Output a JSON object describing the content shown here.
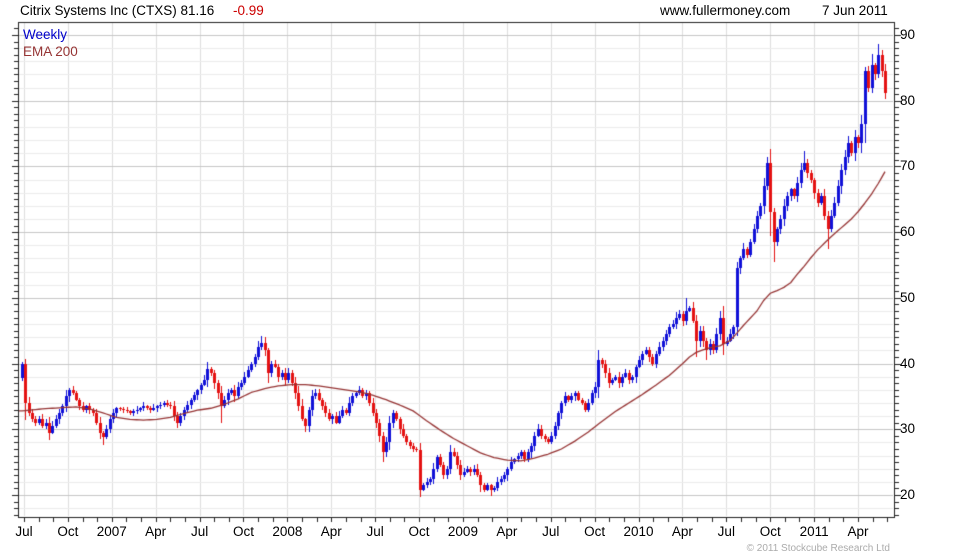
{
  "header": {
    "title": "Citrix Systems Inc (CTXS) 81.16",
    "change": "-0.99",
    "site": "www.fullermoney.com",
    "date": "7 Jun 2011"
  },
  "legend": {
    "timeframe": "Weekly",
    "overlay": "EMA 200"
  },
  "footer": {
    "copyright": "© 2011 Stockcube Research Ltd"
  },
  "colors": {
    "up": "#1111d8",
    "down": "#e41212",
    "ema": "#963434",
    "change_text": "#cc0000",
    "legend_weekly": "#0000cc",
    "axis": "#222222",
    "grid_major": "#c6c6c6",
    "grid_minor": "#ececec",
    "grid_vertical": "#dedede",
    "copyright_text": "#ababab"
  },
  "chart_data": {
    "type": "candlestick",
    "title": "Citrix Systems Inc (CTXS)",
    "last_price": 81.16,
    "change": -0.99,
    "timeframe": "Weekly",
    "overlay": "EMA 200",
    "y_axis": {
      "tick_values": [
        20,
        30,
        40,
        50,
        60,
        70,
        80,
        90
      ],
      "tick_labels": [
        "20",
        "30",
        "40",
        "50",
        "60",
        "70",
        "80",
        "90"
      ],
      "minor_tick_step": 1,
      "minor_grid_step": 2,
      "ylim": [
        16.6,
        92.0
      ],
      "side": "right"
    },
    "x_axis": {
      "tick_labels": [
        "Jul",
        "Oct",
        "2007",
        "Apr",
        "Jul",
        "Oct",
        "2008",
        "Apr",
        "Jul",
        "Oct",
        "2009",
        "Apr",
        "Jul",
        "Oct",
        "2010",
        "Apr",
        "Jul",
        "Oct",
        "2011",
        "Apr"
      ],
      "months_per_tick": 3,
      "range": "Jul 2006 - Jun 2011"
    },
    "weeks": 257,
    "first_open": 37.8,
    "close_anchors": [
      [
        0,
        39.9
      ],
      [
        1,
        34.0
      ],
      [
        2,
        32.5
      ],
      [
        3,
        31.5
      ],
      [
        4,
        31.0
      ],
      [
        5,
        31.5
      ],
      [
        6,
        30.5
      ],
      [
        7,
        31.0
      ],
      [
        8,
        29.5
      ],
      [
        9,
        30.5
      ],
      [
        10,
        31.5
      ],
      [
        11,
        32.5
      ],
      [
        12,
        33.5
      ],
      [
        13,
        35.0
      ],
      [
        14,
        36.0
      ],
      [
        15,
        35.5
      ],
      [
        16,
        34.5
      ],
      [
        17,
        33.5
      ],
      [
        18,
        33.0
      ],
      [
        19,
        33.5
      ],
      [
        20,
        33.0
      ],
      [
        21,
        32.5
      ],
      [
        22,
        31.0
      ],
      [
        23,
        29.5
      ],
      [
        24,
        28.8
      ],
      [
        25,
        30.0
      ],
      [
        26,
        31.5
      ],
      [
        27,
        32.5
      ],
      [
        28,
        33.2
      ],
      [
        30,
        33.0
      ],
      [
        32,
        32.5
      ],
      [
        34,
        33.0
      ],
      [
        36,
        33.5
      ],
      [
        38,
        33.0
      ],
      [
        40,
        33.5
      ],
      [
        42,
        34.0
      ],
      [
        44,
        33.5
      ],
      [
        45,
        32.0
      ],
      [
        46,
        31.0
      ],
      [
        47,
        32.0
      ],
      [
        48,
        33.0
      ],
      [
        50,
        34.5
      ],
      [
        52,
        36.0
      ],
      [
        54,
        37.5
      ],
      [
        55,
        39.2
      ],
      [
        56,
        38.5
      ],
      [
        57,
        37.0
      ],
      [
        58,
        35.5
      ],
      [
        59,
        33.5
      ],
      [
        60,
        34.5
      ],
      [
        61,
        35.5
      ],
      [
        62,
        36.0
      ],
      [
        63,
        35.0
      ],
      [
        64,
        36.5
      ],
      [
        65,
        37.0
      ],
      [
        66,
        38.0
      ],
      [
        67,
        39.0
      ],
      [
        68,
        40.0
      ],
      [
        69,
        41.0
      ],
      [
        70,
        42.5
      ],
      [
        71,
        43.2
      ],
      [
        72,
        42.0
      ],
      [
        73,
        38.5
      ],
      [
        74,
        40.0
      ],
      [
        75,
        39.5
      ],
      [
        76,
        38.0
      ],
      [
        77,
        38.5
      ],
      [
        78,
        37.5
      ],
      [
        79,
        38.5
      ],
      [
        80,
        37.0
      ],
      [
        81,
        35.5
      ],
      [
        82,
        33.5
      ],
      [
        83,
        31.5
      ],
      [
        84,
        30.5
      ],
      [
        85,
        33.0
      ],
      [
        86,
        35.0
      ],
      [
        87,
        35.5
      ],
      [
        88,
        34.5
      ],
      [
        89,
        33.5
      ],
      [
        90,
        32.5
      ],
      [
        91,
        31.5
      ],
      [
        92,
        32.0
      ],
      [
        93,
        31.0
      ],
      [
        94,
        32.0
      ],
      [
        95,
        33.0
      ],
      [
        96,
        32.5
      ],
      [
        97,
        34.0
      ],
      [
        98,
        35.0
      ],
      [
        99,
        35.5
      ],
      [
        100,
        36.0
      ],
      [
        101,
        35.0
      ],
      [
        102,
        35.5
      ],
      [
        103,
        34.0
      ],
      [
        104,
        32.5
      ],
      [
        105,
        31.0
      ],
      [
        106,
        29.0
      ],
      [
        107,
        26.5
      ],
      [
        108,
        28.0
      ],
      [
        109,
        31.0
      ],
      [
        110,
        32.5
      ],
      [
        111,
        31.5
      ],
      [
        112,
        30.0
      ],
      [
        113,
        29.0
      ],
      [
        114,
        28.0
      ],
      [
        115,
        27.5
      ],
      [
        116,
        27.0
      ],
      [
        117,
        26.8
      ],
      [
        118,
        20.8
      ],
      [
        119,
        21.5
      ],
      [
        120,
        22.0
      ],
      [
        121,
        22.5
      ],
      [
        122,
        24.0
      ],
      [
        123,
        25.8
      ],
      [
        124,
        24.5
      ],
      [
        125,
        23.0
      ],
      [
        126,
        24.0
      ],
      [
        127,
        26.5
      ],
      [
        128,
        26.0
      ],
      [
        129,
        24.5
      ],
      [
        130,
        23.0
      ],
      [
        131,
        23.5
      ],
      [
        132,
        24.0
      ],
      [
        133,
        23.5
      ],
      [
        134,
        24.0
      ],
      [
        135,
        23.0
      ],
      [
        136,
        21.5
      ],
      [
        137,
        20.8
      ],
      [
        138,
        21.5
      ],
      [
        139,
        20.8
      ],
      [
        140,
        21.0
      ],
      [
        141,
        22.0
      ],
      [
        142,
        22.5
      ],
      [
        143,
        23.0
      ],
      [
        144,
        24.0
      ],
      [
        145,
        25.0
      ],
      [
        146,
        25.5
      ],
      [
        147,
        26.0
      ],
      [
        148,
        26.5
      ],
      [
        149,
        25.5
      ],
      [
        150,
        26.5
      ],
      [
        151,
        27.5
      ],
      [
        152,
        29.0
      ],
      [
        153,
        30.0
      ],
      [
        154,
        29.0
      ],
      [
        155,
        28.5
      ],
      [
        156,
        28.0
      ],
      [
        157,
        29.0
      ],
      [
        158,
        30.5
      ],
      [
        159,
        32.5
      ],
      [
        160,
        34.0
      ],
      [
        161,
        35.0
      ],
      [
        162,
        34.5
      ],
      [
        163,
        35.0
      ],
      [
        164,
        35.5
      ],
      [
        165,
        34.5
      ],
      [
        166,
        34.0
      ],
      [
        167,
        33.0
      ],
      [
        168,
        34.0
      ],
      [
        169,
        35.5
      ],
      [
        170,
        36.5
      ],
      [
        171,
        40.5
      ],
      [
        172,
        40.0
      ],
      [
        173,
        38.5
      ],
      [
        174,
        37.0
      ],
      [
        175,
        37.5
      ],
      [
        176,
        38.0
      ],
      [
        177,
        37.0
      ],
      [
        178,
        38.0
      ],
      [
        179,
        38.5
      ],
      [
        180,
        37.5
      ],
      [
        181,
        38.0
      ],
      [
        182,
        39.5
      ],
      [
        183,
        40.5
      ],
      [
        184,
        41.5
      ],
      [
        185,
        42.0
      ],
      [
        186,
        41.0
      ],
      [
        187,
        40.0
      ],
      [
        188,
        41.5
      ],
      [
        189,
        42.5
      ],
      [
        190,
        43.5
      ],
      [
        191,
        44.5
      ],
      [
        192,
        45.5
      ],
      [
        193,
        46.0
      ],
      [
        194,
        47.0
      ],
      [
        195,
        47.5
      ],
      [
        196,
        46.5
      ],
      [
        197,
        48.0
      ],
      [
        198,
        48.5
      ],
      [
        199,
        46.5
      ],
      [
        200,
        43.5
      ],
      [
        201,
        45.0
      ],
      [
        202,
        43.5
      ],
      [
        203,
        42.0
      ],
      [
        204,
        43.0
      ],
      [
        205,
        42.0
      ],
      [
        206,
        44.5
      ],
      [
        207,
        47.0
      ],
      [
        208,
        43.0
      ],
      [
        209,
        43.5
      ],
      [
        210,
        44.5
      ],
      [
        211,
        45.5
      ],
      [
        212,
        54.5
      ],
      [
        213,
        56.0
      ],
      [
        214,
        57.5
      ],
      [
        215,
        56.5
      ],
      [
        216,
        58.5
      ],
      [
        217,
        60.5
      ],
      [
        218,
        62.5
      ],
      [
        219,
        64.0
      ],
      [
        220,
        67.0
      ],
      [
        221,
        70.5
      ],
      [
        222,
        63.0
      ],
      [
        223,
        58.5
      ],
      [
        224,
        60.5
      ],
      [
        225,
        62.0
      ],
      [
        226,
        64.0
      ],
      [
        227,
        65.5
      ],
      [
        228,
        66.5
      ],
      [
        229,
        65.5
      ],
      [
        230,
        67.5
      ],
      [
        231,
        69.5
      ],
      [
        232,
        70.5
      ],
      [
        233,
        69.0
      ],
      [
        234,
        68.0
      ],
      [
        235,
        66.0
      ],
      [
        236,
        64.5
      ],
      [
        237,
        65.5
      ],
      [
        238,
        62.5
      ],
      [
        239,
        60.5
      ],
      [
        240,
        62.5
      ],
      [
        241,
        64.5
      ],
      [
        242,
        67.0
      ],
      [
        243,
        69.5
      ],
      [
        244,
        71.5
      ],
      [
        245,
        73.5
      ],
      [
        246,
        72.0
      ],
      [
        247,
        74.5
      ],
      [
        248,
        73.5
      ],
      [
        249,
        76.5
      ],
      [
        250,
        84.5
      ],
      [
        251,
        82.0
      ],
      [
        252,
        85.5
      ],
      [
        253,
        84.0
      ],
      [
        254,
        87.0
      ],
      [
        255,
        84.5
      ],
      [
        256,
        81.16
      ]
    ],
    "ema_anchors": [
      [
        0,
        32.8
      ],
      [
        6,
        33.1
      ],
      [
        12,
        33.3
      ],
      [
        16,
        33.4
      ],
      [
        20,
        33.1
      ],
      [
        24,
        32.5
      ],
      [
        28,
        31.8
      ],
      [
        32,
        31.5
      ],
      [
        36,
        31.4
      ],
      [
        40,
        31.5
      ],
      [
        44,
        31.8
      ],
      [
        48,
        32.4
      ],
      [
        52,
        32.9
      ],
      [
        56,
        33.2
      ],
      [
        60,
        33.8
      ],
      [
        64,
        34.6
      ],
      [
        68,
        35.6
      ],
      [
        72,
        36.2
      ],
      [
        76,
        36.6
      ],
      [
        80,
        36.8
      ],
      [
        84,
        36.8
      ],
      [
        88,
        36.6
      ],
      [
        92,
        36.3
      ],
      [
        96,
        36.0
      ],
      [
        100,
        35.7
      ],
      [
        104,
        35.2
      ],
      [
        108,
        34.5
      ],
      [
        112,
        33.7
      ],
      [
        116,
        32.8
      ],
      [
        120,
        31.3
      ],
      [
        124,
        29.9
      ],
      [
        128,
        28.6
      ],
      [
        132,
        27.5
      ],
      [
        136,
        26.4
      ],
      [
        140,
        25.7
      ],
      [
        144,
        25.3
      ],
      [
        148,
        25.2
      ],
      [
        152,
        25.6
      ],
      [
        156,
        26.2
      ],
      [
        160,
        27.0
      ],
      [
        164,
        28.2
      ],
      [
        168,
        29.6
      ],
      [
        172,
        31.2
      ],
      [
        176,
        32.7
      ],
      [
        180,
        34.0
      ],
      [
        184,
        35.3
      ],
      [
        188,
        36.7
      ],
      [
        192,
        38.2
      ],
      [
        196,
        40.0
      ],
      [
        198,
        41.0
      ],
      [
        200,
        41.7
      ],
      [
        202,
        42.1
      ],
      [
        204,
        42.4
      ],
      [
        207,
        42.7
      ],
      [
        210,
        43.5
      ],
      [
        212,
        44.6
      ],
      [
        214,
        45.8
      ],
      [
        216,
        46.9
      ],
      [
        218,
        48.0
      ],
      [
        220,
        49.6
      ],
      [
        222,
        50.7
      ],
      [
        224,
        51.1
      ],
      [
        226,
        51.6
      ],
      [
        228,
        52.3
      ],
      [
        230,
        53.6
      ],
      [
        232,
        54.8
      ],
      [
        234,
        56.1
      ],
      [
        236,
        57.3
      ],
      [
        238,
        58.3
      ],
      [
        240,
        59.3
      ],
      [
        242,
        60.2
      ],
      [
        244,
        61.1
      ],
      [
        246,
        62.0
      ],
      [
        248,
        63.1
      ],
      [
        250,
        64.4
      ],
      [
        252,
        65.8
      ],
      [
        254,
        67.4
      ],
      [
        256,
        69.2
      ]
    ],
    "wick_overrides": {
      "0": {
        "high": 40.3
      },
      "1": {
        "low": 31.4
      },
      "8": {
        "low": 28.4
      },
      "24": {
        "low": 27.6
      },
      "46": {
        "low": 30.2
      },
      "55": {
        "high": 40.2
      },
      "59": {
        "low": 31.0
      },
      "71": {
        "high": 44.2
      },
      "84": {
        "low": 29.6
      },
      "107": {
        "low": 25.0
      },
      "118": {
        "low": 19.7
      },
      "139": {
        "low": 19.9
      },
      "153": {
        "high": 30.8
      },
      "171": {
        "high": 42.0
      },
      "197": {
        "high": 50.0
      },
      "200": {
        "low": 41.0
      },
      "203": {
        "low": 40.6
      },
      "221": {
        "high": 71.4
      },
      "222": {
        "low": 59.4
      },
      "223": {
        "low": 55.4
      },
      "232": {
        "high": 72.3
      },
      "239": {
        "low": 57.4
      },
      "244": {
        "high": 72.5
      },
      "250": {
        "high": 85.2
      },
      "254": {
        "high": 88.7
      },
      "256": {
        "low": 80.2
      }
    }
  }
}
